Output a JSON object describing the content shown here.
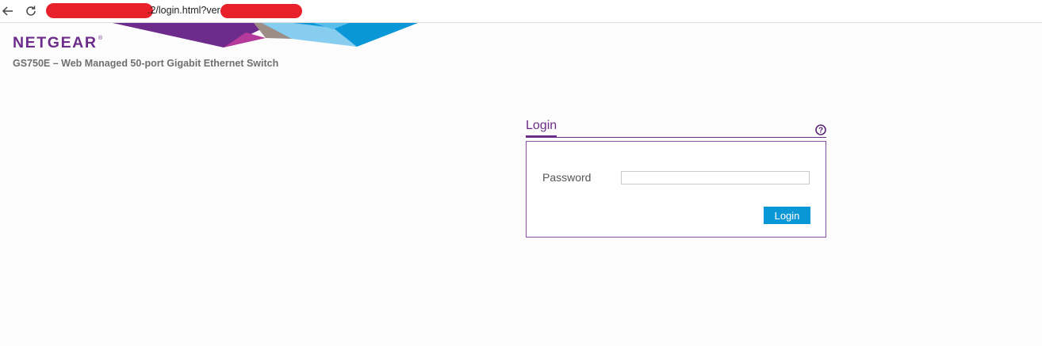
{
  "browser": {
    "url_visible_middle": ".2/login.html?ver",
    "redaction_color": "#e8202a"
  },
  "header": {
    "logo_text": "NETGEAR",
    "logo_mark": "®",
    "product_title": "GS750E – Web Managed 50-port Gigabit Ethernet Switch",
    "brand_color": "#6c2c8a"
  },
  "login": {
    "tab_label": "Login",
    "password_label": "Password",
    "password_value": "",
    "button_label": "Login",
    "button_color": "#0a97d8",
    "help_icon": "help-question-icon"
  }
}
